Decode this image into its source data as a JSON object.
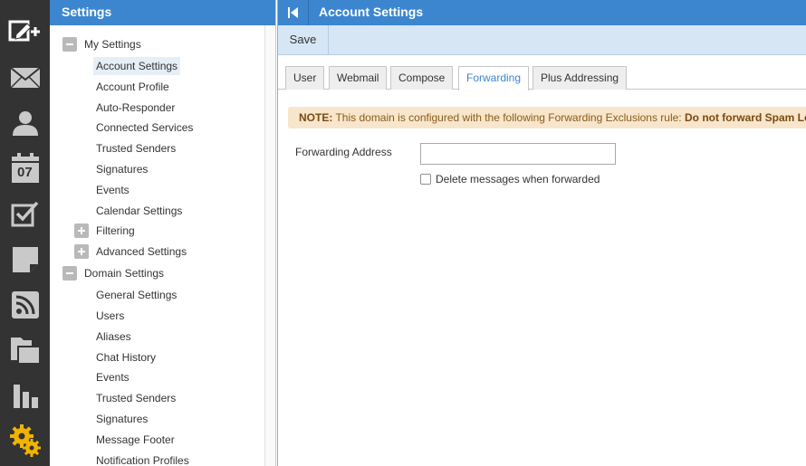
{
  "rail": {
    "items": [
      {
        "icon": "compose-new-icon"
      },
      {
        "icon": "mail-icon"
      },
      {
        "icon": "contacts-icon"
      },
      {
        "icon": "calendar-icon",
        "text": "07"
      },
      {
        "icon": "tasks-icon"
      },
      {
        "icon": "notes-icon"
      },
      {
        "icon": "rss-icon"
      },
      {
        "icon": "documents-icon"
      },
      {
        "icon": "reports-icon"
      },
      {
        "icon": "settings-gears-icon"
      }
    ],
    "colors": {
      "background": "#333333",
      "icon": "#ffffff",
      "active": "#f0b400"
    }
  },
  "settings_panel": {
    "title": "Settings",
    "my_settings": {
      "label": "My Settings",
      "items": [
        "Account Settings",
        "Account Profile",
        "Auto-Responder",
        "Connected Services",
        "Trusted Senders",
        "Signatures",
        "Events",
        "Calendar Settings"
      ],
      "collapsed": [
        "Filtering",
        "Advanced Settings"
      ]
    },
    "domain_settings": {
      "label": "Domain Settings",
      "items": [
        "General Settings",
        "Users",
        "Aliases",
        "Chat History",
        "Events",
        "Trusted Senders",
        "Signatures",
        "Message Footer",
        "Notification Profiles"
      ]
    },
    "selected": "Account Settings"
  },
  "main": {
    "title": "Account Settings",
    "toolbar": {
      "save_label": "Save"
    },
    "tabs": [
      "User",
      "Webmail",
      "Compose",
      "Forwarding",
      "Plus Addressing"
    ],
    "active_tab": "Forwarding",
    "note": {
      "prefix": "NOTE:",
      "text": " This domain is configured with the following Forwarding Exclusions rule: ",
      "rule": "Do not forward Spam Le"
    },
    "form": {
      "forwarding_address_label": "Forwarding Address",
      "forwarding_address_value": "",
      "delete_when_forwarded_label": "Delete messages when forwarded",
      "delete_when_forwarded_checked": false
    }
  },
  "colors": {
    "accent": "#3c86cf",
    "toolbar": "#d6e6f4",
    "note_bg": "#f7e6cc",
    "note_text": "#8a5a1a"
  }
}
